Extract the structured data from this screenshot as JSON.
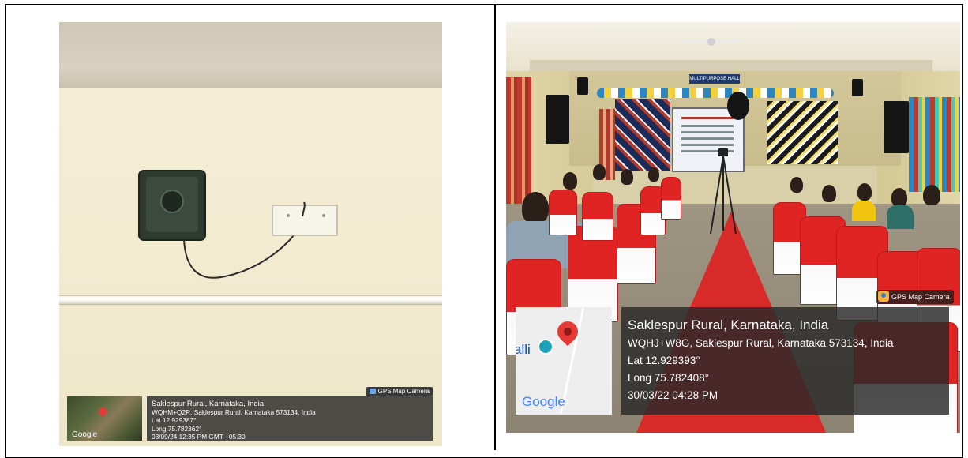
{
  "left_photo": {
    "stamp": {
      "badge": "GPS Map Camera",
      "map_brand": "Google",
      "place": "Saklespur Rural, Karnataka, India",
      "address": "WQHM+Q2R, Saklespur Rural, Karnataka 573134, India",
      "lat": "Lat 12.929387°",
      "long": "Long 75.782362°",
      "datetime": "03/09/24 12:35 PM GMT +05:30"
    }
  },
  "right_photo": {
    "hall_banner": "MULTIPURPOSE HALL",
    "stamp": {
      "badge": "GPS Map Camera",
      "map_label": "alli",
      "map_brand": "Google",
      "place": "Saklespur Rural, Karnataka, India",
      "address": "WQHJ+W8G, Saklespur Rural, Karnataka 573134, India",
      "lat": "Lat 12.929393°",
      "long": "Long 75.782408°",
      "datetime": "30/03/22 04:28 PM"
    }
  },
  "colors": {
    "overlay_bg": "#282828",
    "map_pin": "#e53935",
    "carpet": "#d92a2a",
    "chair_red": "#e02424"
  }
}
